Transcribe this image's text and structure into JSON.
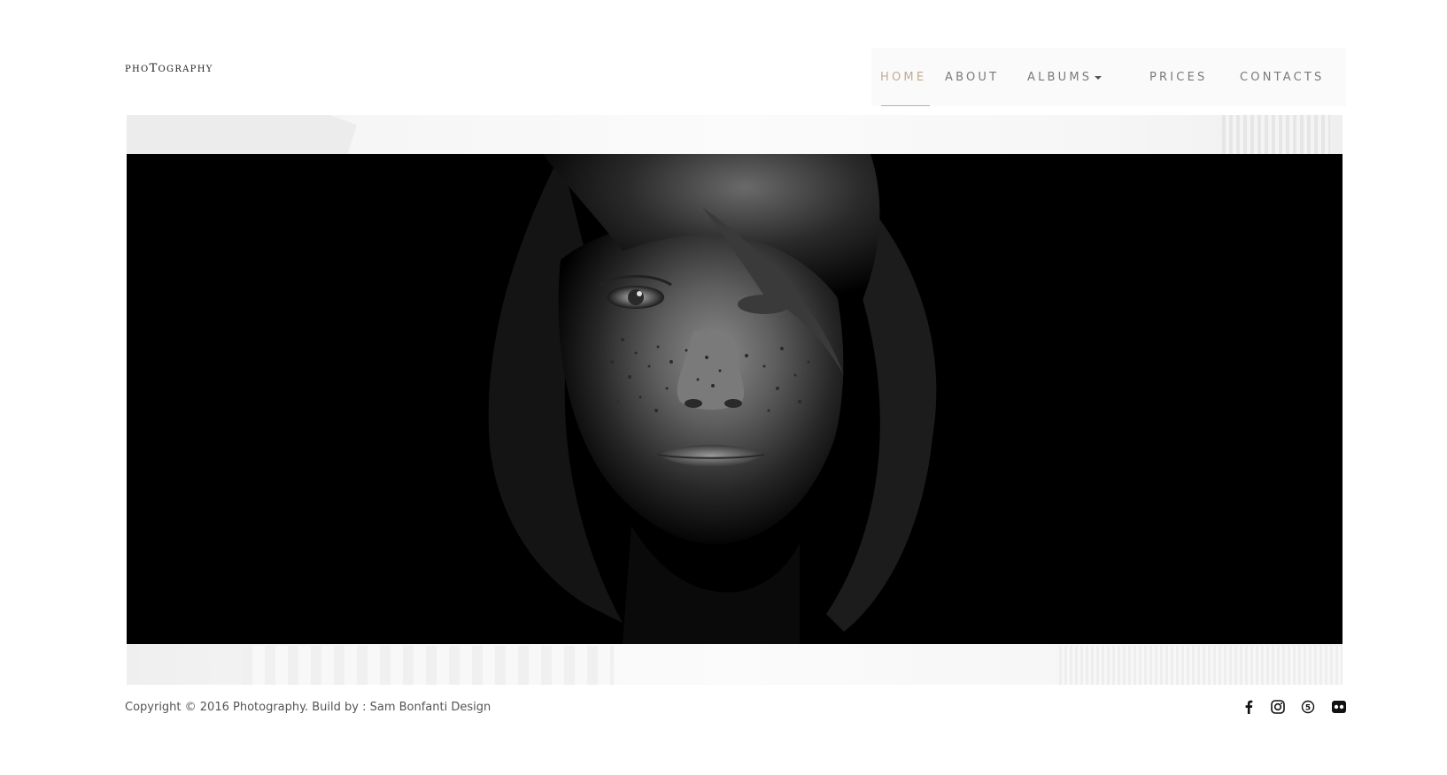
{
  "header": {
    "logo_first": "P",
    "logo_mid1": "HO",
    "logo_big": "T",
    "logo_mid2": "OGRAPHY"
  },
  "nav": {
    "items": [
      {
        "label": "HOME",
        "active": true
      },
      {
        "label": "ABOUT"
      },
      {
        "label": "ALBUMS",
        "dropdown": true
      },
      {
        "label": "PRICES"
      },
      {
        "label": "CONTACTS"
      }
    ],
    "active_color": "#c4ab90",
    "text_color": "#7a7a7a"
  },
  "hero": {
    "image_description_icon": "portrait-photo"
  },
  "footer": {
    "copyright": "Copyright © 2016 Photography. Build by : Sam Bonfanti Design",
    "social": [
      {
        "icon": "facebook-icon"
      },
      {
        "icon": "instagram-icon"
      },
      {
        "icon": "500px-icon"
      },
      {
        "icon": "flickr-icon"
      }
    ]
  }
}
